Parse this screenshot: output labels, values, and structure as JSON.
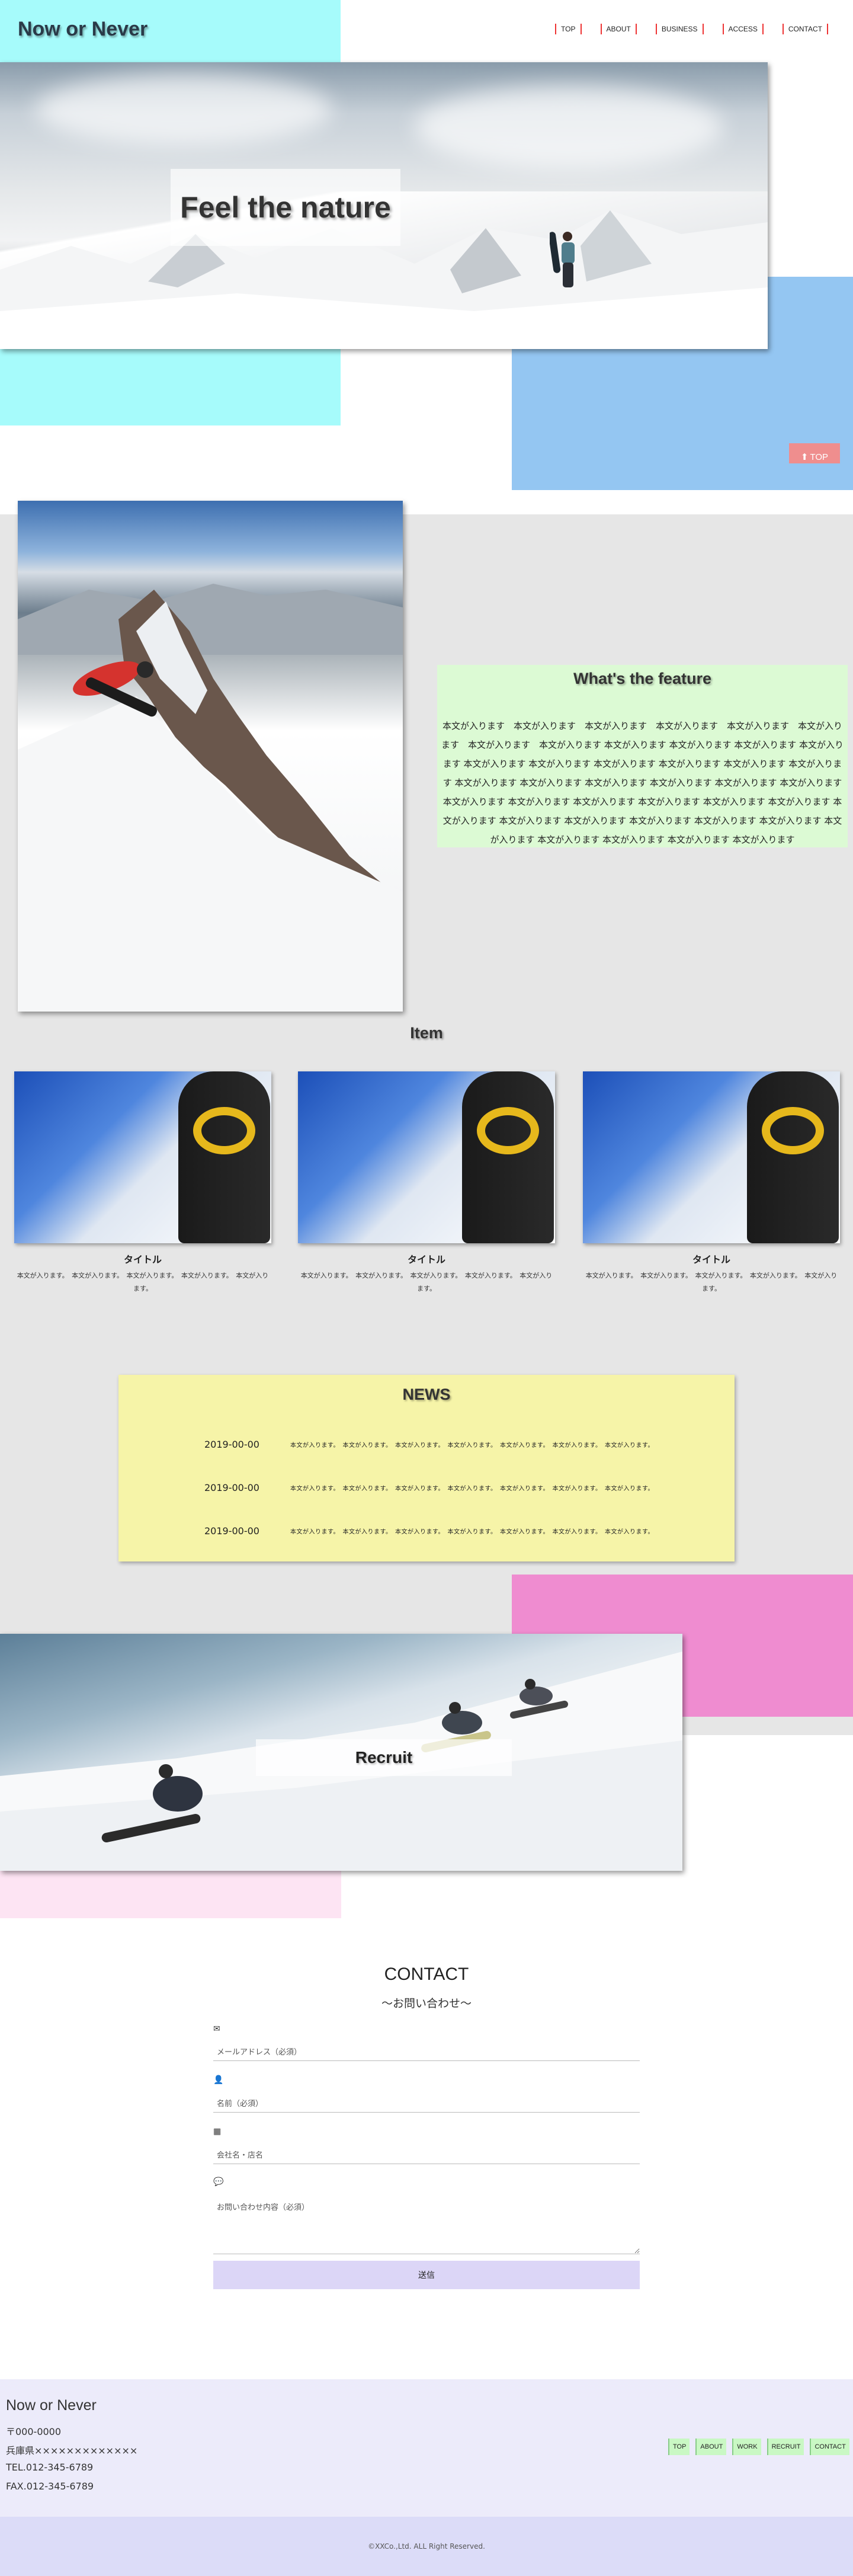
{
  "header": {
    "logo": "Now or Never",
    "nav": [
      "TOP",
      "ABOUT",
      "BUSINESS",
      "ACCESS",
      "CONTACT"
    ]
  },
  "hero": {
    "title": "Feel the nature"
  },
  "top_button": {
    "label": "TOP"
  },
  "feature": {
    "title": "What's the feature",
    "body": "本文が入ります　本文が入ります　本文が入ります　本文が入ります　本文が入ります　本文が入ります　本文が入ります　本文が入ります 本文が入ります 本文が入ります 本文が入ります 本文が入ります 本文が入ります 本文が入ります 本文が入ります 本文が入ります 本文が入ります 本文が入ります 本文が入ります 本文が入ります 本文が入ります 本文が入ります 本文が入ります 本文が入ります 本文が入ります 本文が入ります 本文が入ります 本文が入ります 本文が入ります 本文が入ります 本文が入ります 本文が入ります 本文が入ります 本文が入ります 本文が入ります 本文が入ります 本文が入ります 本文が入ります 本文が入ります 本文が入ります 本文が入ります"
  },
  "items": {
    "heading": "Item",
    "list": [
      {
        "title": "タイトル",
        "text": "本文が入ります。　本文が入ります。　本文が入ります。　本文が入ります。　本文が入ります。"
      },
      {
        "title": "タイトル",
        "text": "本文が入ります。　本文が入ります。　本文が入ります。　本文が入ります。　本文が入ります。"
      },
      {
        "title": "タイトル",
        "text": "本文が入ります。　本文が入ります。　本文が入ります。　本文が入ります。　本文が入ります。"
      }
    ]
  },
  "news": {
    "heading": "NEWS",
    "entries": [
      {
        "date": "2019-00-00",
        "text": "本文が入ります。　本文が入ります。　本文が入ります。　本文が入ります。　本文が入ります。　本文が入ります。　本文が入ります。"
      },
      {
        "date": "2019-00-00",
        "text": "本文が入ります。　本文が入ります。　本文が入ります。　本文が入ります。　本文が入ります。　本文が入ります。　本文が入ります。"
      },
      {
        "date": "2019-00-00",
        "text": "本文が入ります。　本文が入ります。　本文が入ります。　本文が入ります。　本文が入ります。　本文が入ります。　本文が入ります。"
      }
    ]
  },
  "recruit": {
    "label": "Recruit"
  },
  "contact": {
    "heading": "CONTACT",
    "subheading": "〜お問い合わせ〜",
    "email_placeholder": "メールアドレス（必須）",
    "name_placeholder": "名前（必須）",
    "company_placeholder": "会社名・店名",
    "message_placeholder": "お問い合わせ内容（必須）",
    "submit_label": "送信"
  },
  "footer": {
    "logo": "Now or Never",
    "postal": "〒000-0000",
    "address": "兵庫県×××××××××××××",
    "tel": "TEL.012-345-6789",
    "fax": "FAX.012-345-6789",
    "nav": [
      "TOP",
      "ABOUT",
      "WORK",
      "RECRUIT",
      "CONTACT"
    ],
    "copyright": "©XXCo.,Ltd. ALL Right Reserved."
  },
  "colors": {
    "cyan": "#a6fbfb",
    "blue": "#94c6f2",
    "gray": "#e6e6e6",
    "feature_green": "#dcfad4",
    "news_yellow": "#f6f4a8",
    "pink": "#ef8cd0",
    "footer_lavender": "#ecebfa",
    "nav_accent": "#e33333"
  },
  "icons": {
    "email": "envelope-icon",
    "name": "user-icon",
    "company": "building-icon",
    "message": "comments-icon",
    "top": "arrow-up-circle-icon"
  }
}
